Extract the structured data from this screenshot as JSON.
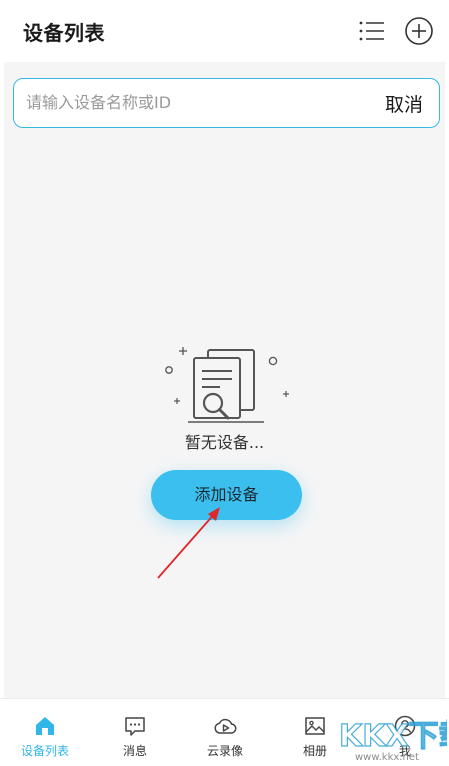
{
  "header": {
    "title": "设备列表",
    "list_icon": "list-icon",
    "add_icon": "plus-circle-icon"
  },
  "search": {
    "placeholder": "请输入设备名称或ID",
    "value": "",
    "cancel_label": "取消"
  },
  "empty_state": {
    "icon": "document-search-icon",
    "text": "暂无设备...",
    "add_button_label": "添加设备"
  },
  "tabs": [
    {
      "label": "设备列表",
      "icon": "home-icon",
      "active": true
    },
    {
      "label": "消息",
      "icon": "message-icon",
      "active": false
    },
    {
      "label": "云录像",
      "icon": "cloud-play-icon",
      "active": false
    },
    {
      "label": "相册",
      "icon": "picture-icon",
      "active": false
    },
    {
      "label": "我",
      "icon": "user-icon",
      "active": false
    }
  ],
  "watermark": {
    "text": "KKX下载",
    "url": "www.kkx.net"
  },
  "colors": {
    "accent": "#3bbfef",
    "active_tab": "#30b6e8",
    "annotation_arrow": "#e0262a",
    "background": "#f5f5f6"
  }
}
